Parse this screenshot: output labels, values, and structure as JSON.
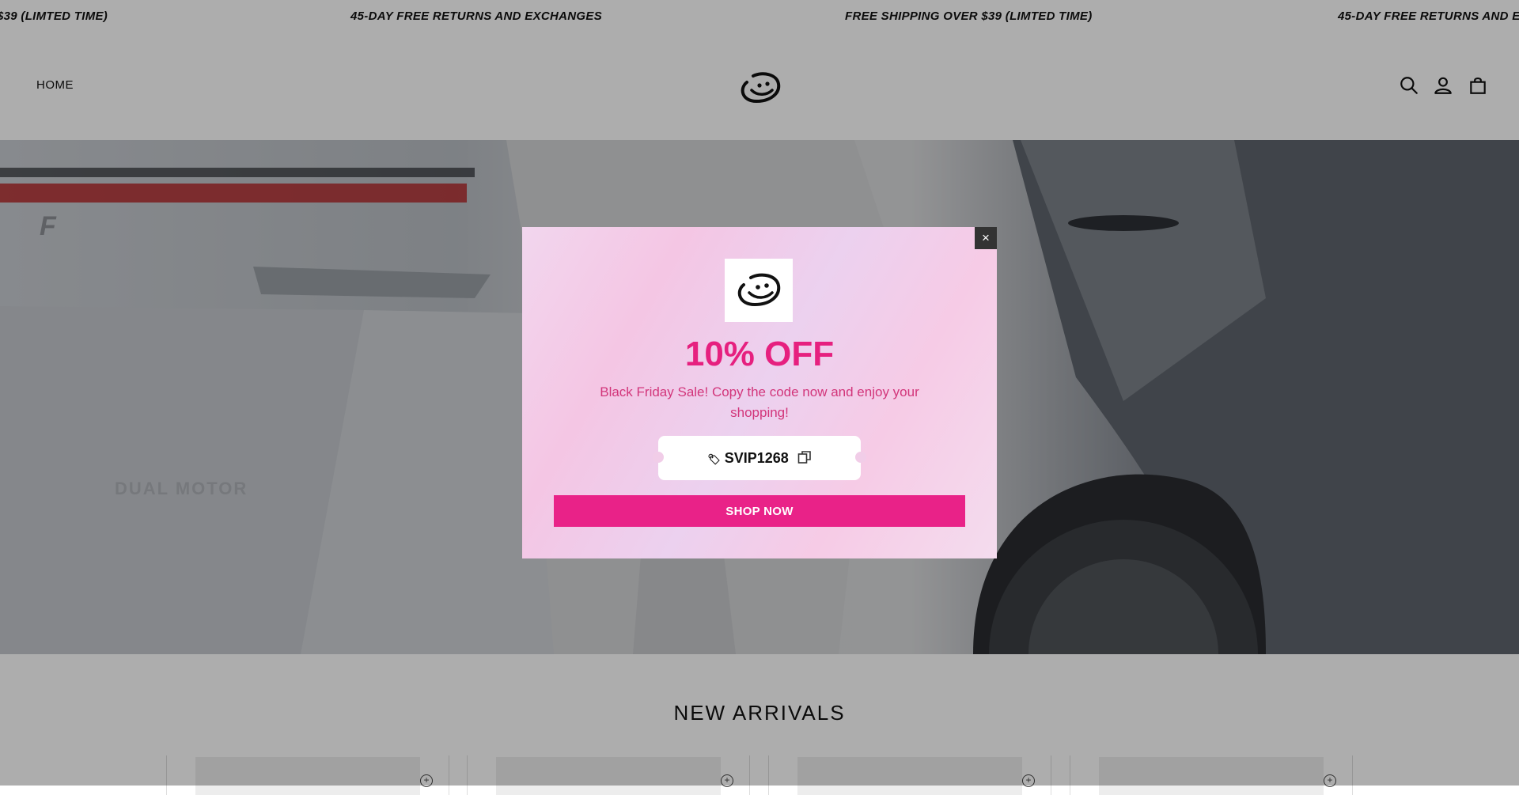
{
  "announcement": {
    "messages": [
      "$39 (LIMTED TIME)",
      "45-DAY FREE RETURNS AND EXCHANGES",
      "FREE SHIPPING OVER $39 (LIMTED TIME)",
      "45-DAY FREE RETURNS AND E"
    ]
  },
  "header": {
    "nav_home": "HOME",
    "icons": [
      "search-icon",
      "account-icon",
      "cart-icon"
    ]
  },
  "hero": {
    "badge_text": "DUAL MOTOR"
  },
  "section": {
    "title": "NEW ARRIVALS",
    "cards": 4
  },
  "popup": {
    "title": "10% OFF",
    "description": "Black Friday Sale! Copy the code now and enjoy your shopping!",
    "coupon_code": "SVIP1268",
    "button_label": "SHOP NOW",
    "close_label": "×",
    "accent_color": "#e92288",
    "title_color": "#e6207f"
  }
}
